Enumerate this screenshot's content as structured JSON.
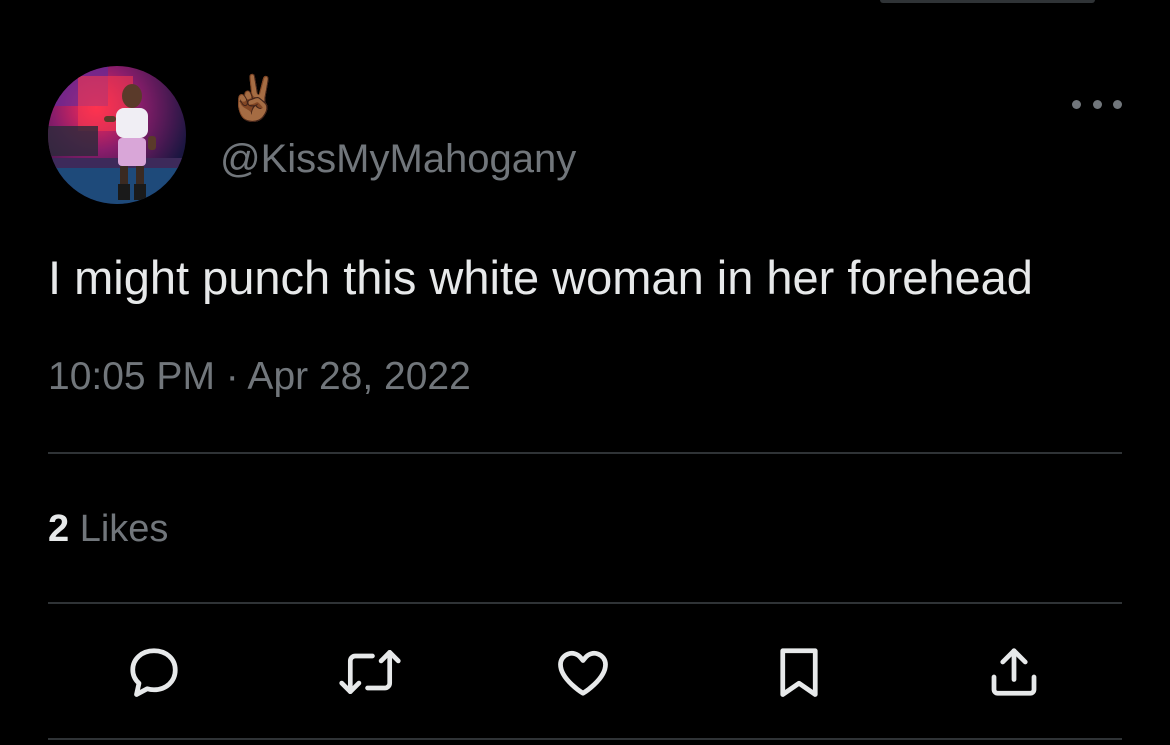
{
  "author": {
    "display_name": "✌🏾",
    "handle": "@KissMyMahogany",
    "avatar_icon": "profile-photo"
  },
  "tweet": {
    "text": "I might punch this white woman in her forehead",
    "timestamp": "10:05 PM · Apr 28, 2022"
  },
  "stats": {
    "likes_count": "2",
    "likes_label": "Likes"
  },
  "actions": [
    {
      "icon": "reply-icon"
    },
    {
      "icon": "retweet-icon"
    },
    {
      "icon": "like-icon"
    },
    {
      "icon": "bookmark-icon"
    },
    {
      "icon": "share-icon"
    }
  ],
  "colors": {
    "background": "#000000",
    "primary_text": "#e7e9ea",
    "secondary_text": "#71767b",
    "divider": "#2f3336",
    "icon": "#e7e9ea"
  }
}
